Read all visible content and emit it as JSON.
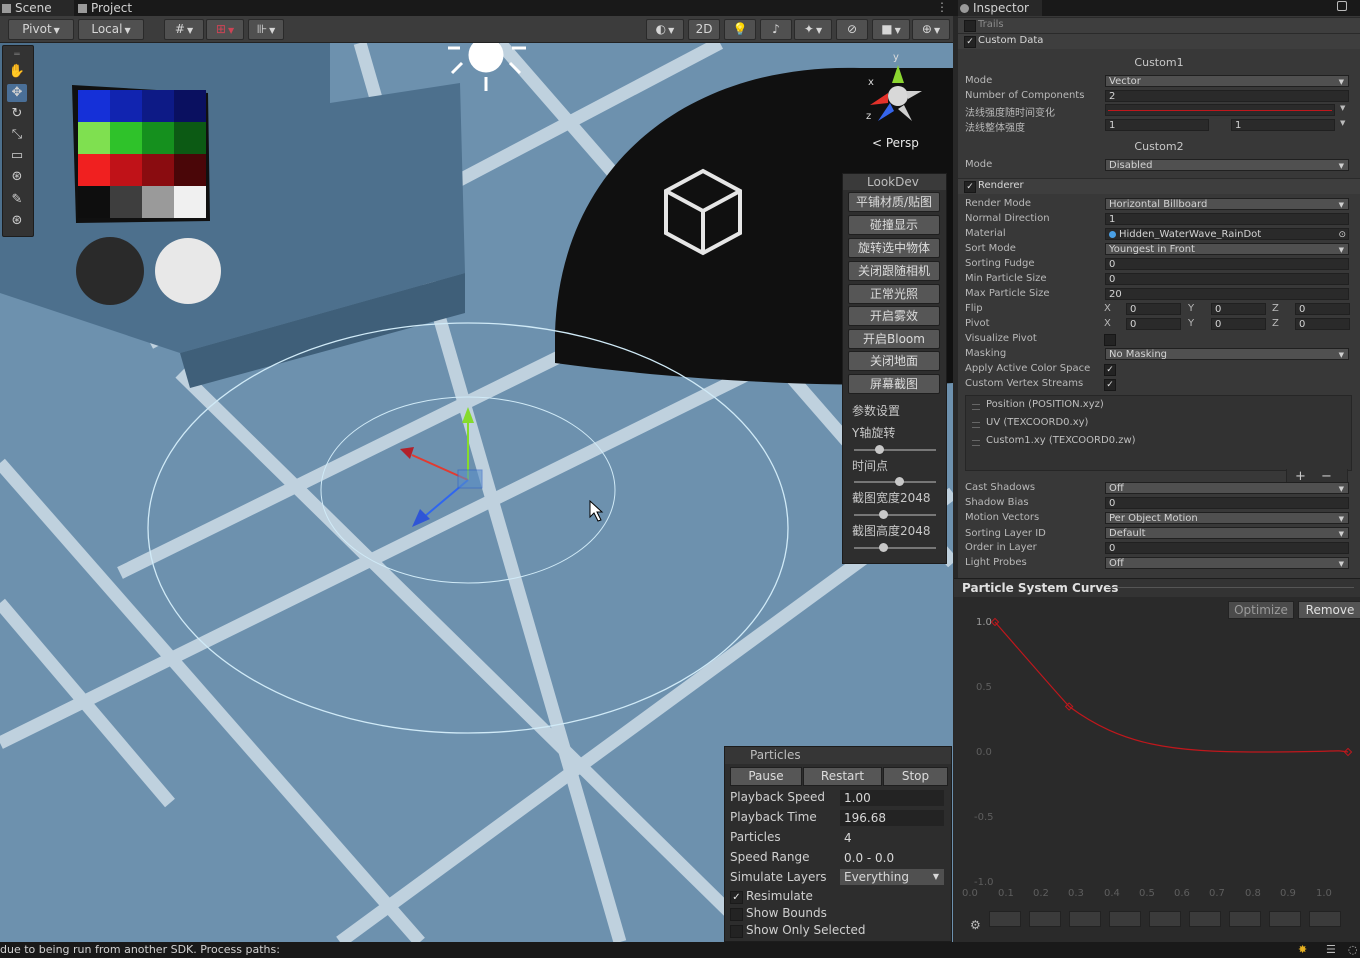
{
  "tabs": {
    "scene": "Scene",
    "project": "Project",
    "inspector": "Inspector"
  },
  "scene_toolbar": {
    "pivot": "Pivot",
    "local": "Local",
    "mode_2d": "2D"
  },
  "scene_view": {
    "camera_label": "< Persp",
    "axis_x": "x",
    "axis_y": "y",
    "axis_z": "z"
  },
  "lookdev": {
    "title": "LookDev",
    "buttons": [
      "平铺材质/贴图",
      "碰撞显示",
      "旋转选中物体",
      "关闭跟随相机",
      "正常光照",
      "开启雾效",
      "开启Bloom",
      "关闭地面",
      "屏幕截图"
    ],
    "section": "参数设置",
    "sliders": [
      {
        "label": "Y轴旋转",
        "value": 0.3
      },
      {
        "label": "时间点",
        "value": 0.55
      },
      {
        "label": "截图宽度2048",
        "value": 0.35
      },
      {
        "label": "截图高度2048",
        "value": 0.35
      }
    ]
  },
  "particles": {
    "title": "Particles",
    "buttons": {
      "pause": "Pause",
      "restart": "Restart",
      "stop": "Stop"
    },
    "fields": [
      {
        "label": "Playback Speed",
        "value": "1.00"
      },
      {
        "label": "Playback Time",
        "value": "196.68"
      },
      {
        "label": "Particles",
        "value": "4"
      },
      {
        "label": "Speed Range",
        "value": "0.0 - 0.0"
      },
      {
        "label": "Simulate Layers",
        "value": "Everything"
      }
    ],
    "checks": [
      {
        "label": "Resimulate",
        "checked": true
      },
      {
        "label": "Show Bounds",
        "checked": false
      },
      {
        "label": "Show Only Selected",
        "checked": false
      }
    ]
  },
  "status": {
    "message": "due to being run from another SDK. Process paths:"
  },
  "inspector": {
    "trails_label": "Trails",
    "custom_data_label": "Custom Data",
    "custom1": {
      "title": "Custom1",
      "mode_label": "Mode",
      "mode_value": "Vector",
      "components_label": "Number of Components",
      "components_value": "2",
      "curve_label": "法线强度随时间变化",
      "intensity_label": "法线整体强度",
      "intensity_a": "1",
      "intensity_b": "1"
    },
    "custom2": {
      "title": "Custom2",
      "mode_label": "Mode",
      "mode_value": "Disabled"
    },
    "renderer_label": "Renderer",
    "renderer_rows": [
      {
        "label": "Render Mode",
        "value": "Horizontal Billboard",
        "dropdown": true
      },
      {
        "label": "Normal Direction",
        "value": "1",
        "dropdown": false
      },
      {
        "label": "Material",
        "value": "Hidden_WaterWave_RainDot",
        "dropdown": false
      },
      {
        "label": "Sort Mode",
        "value": "Youngest in Front",
        "dropdown": true
      },
      {
        "label": "Sorting Fudge",
        "value": "0",
        "dropdown": false
      },
      {
        "label": "Min Particle Size",
        "value": "0",
        "dropdown": false
      },
      {
        "label": "Max Particle Size",
        "value": "20",
        "dropdown": false
      }
    ],
    "flip": {
      "label": "Flip",
      "x": "0",
      "y": "0",
      "z": "0"
    },
    "pivot": {
      "label": "Pivot",
      "x": "0",
      "y": "0",
      "z": "0"
    },
    "xyz_labels": {
      "x": "X",
      "y": "Y",
      "z": "Z"
    },
    "visualize_pivot_label": "Visualize Pivot",
    "masking": {
      "label": "Masking",
      "value": "No Masking"
    },
    "apply_active_color_space_label": "Apply Active Color Space",
    "custom_vertex_streams_label": "Custom Vertex Streams",
    "streams": [
      "Position (POSITION.xyz)",
      "UV (TEXCOORD0.xy)",
      "Custom1.xy (TEXCOORD0.zw)"
    ],
    "stream_add": "+",
    "stream_remove": "−",
    "lower_rows": [
      {
        "label": "Cast Shadows",
        "value": "Off",
        "dropdown": true
      },
      {
        "label": "Shadow Bias",
        "value": "0",
        "dropdown": false
      },
      {
        "label": "Motion Vectors",
        "value": "Per Object Motion",
        "dropdown": true
      },
      {
        "label": "Sorting Layer ID",
        "value": "Default",
        "dropdown": true
      },
      {
        "label": "Order in Layer",
        "value": "0",
        "dropdown": false
      },
      {
        "label": "Light Probes",
        "value": "Off",
        "dropdown": true
      }
    ]
  },
  "curves": {
    "title": "Particle System Curves",
    "optimize": "Optimize",
    "remove": "Remove",
    "y_ticks": [
      "1.0",
      "0.5",
      "0.0",
      "-0.5",
      "-1.0"
    ],
    "x_ticks": [
      "0.0",
      "0.1",
      "0.2",
      "0.3",
      "0.4",
      "0.5",
      "0.6",
      "0.7",
      "0.8",
      "0.9",
      "1.0"
    ],
    "curve_color": "#c0171c",
    "keys": [
      {
        "t": 0.0,
        "v": 1.0
      },
      {
        "t": 0.21,
        "v": 0.35
      },
      {
        "t": 1.0,
        "v": 0.0
      }
    ]
  },
  "colors": {
    "sky": "#6d91ae",
    "dome": "#101010",
    "panel": "#383838",
    "accent_curve": "#c0171c"
  }
}
